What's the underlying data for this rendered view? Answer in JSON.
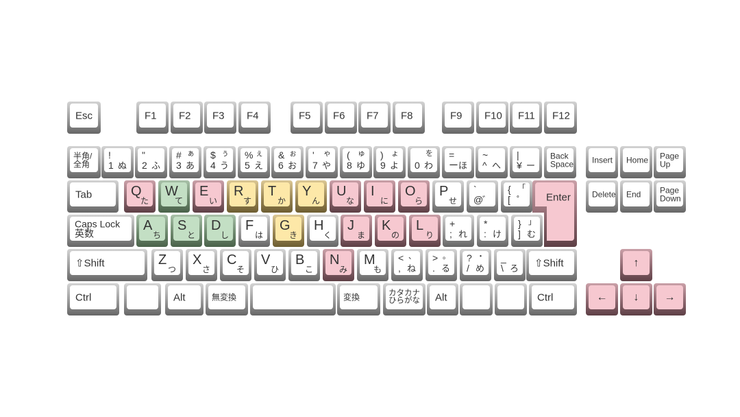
{
  "colors": {
    "default": "#ffffff",
    "pink": "#f6c8d0",
    "green": "#c3dfc4",
    "yellow": "#fde8a8"
  },
  "keys": [
    {
      "id": "esc",
      "label": "Esc",
      "type": "name",
      "color": "default"
    },
    {
      "id": "f1",
      "label": "F1",
      "type": "name",
      "color": "default"
    },
    {
      "id": "f2",
      "label": "F2",
      "type": "name",
      "color": "default"
    },
    {
      "id": "f3",
      "label": "F3",
      "type": "name",
      "color": "default"
    },
    {
      "id": "f4",
      "label": "F4",
      "type": "name",
      "color": "default"
    },
    {
      "id": "f5",
      "label": "F5",
      "type": "name",
      "color": "default"
    },
    {
      "id": "f6",
      "label": "F6",
      "type": "name",
      "color": "default"
    },
    {
      "id": "f7",
      "label": "F7",
      "type": "name",
      "color": "default"
    },
    {
      "id": "f8",
      "label": "F8",
      "type": "name",
      "color": "default"
    },
    {
      "id": "f9",
      "label": "F9",
      "type": "name",
      "color": "default"
    },
    {
      "id": "f10",
      "label": "F10",
      "type": "name",
      "color": "default"
    },
    {
      "id": "f11",
      "label": "F11",
      "type": "name",
      "color": "default"
    },
    {
      "id": "f12",
      "label": "F12",
      "type": "name",
      "color": "default"
    },
    {
      "id": "hankaku",
      "label": "半角/\n全角",
      "type": "name-small",
      "color": "default"
    },
    {
      "id": "k1",
      "tl": "!",
      "tr": "",
      "bl": "1",
      "br": "ぬ",
      "type": "num",
      "color": "default"
    },
    {
      "id": "k2",
      "tl": "\"",
      "tr": "",
      "bl": "2",
      "br": "ふ",
      "type": "num",
      "color": "default"
    },
    {
      "id": "k3",
      "tl": "#",
      "tr": "ぁ",
      "bl": "3",
      "br": "あ",
      "type": "num",
      "color": "default"
    },
    {
      "id": "k4",
      "tl": "$",
      "tr": "ぅ",
      "bl": "4",
      "br": "う",
      "type": "num",
      "color": "default"
    },
    {
      "id": "k5",
      "tl": "%",
      "tr": "ぇ",
      "bl": "5",
      "br": "え",
      "type": "num",
      "color": "default"
    },
    {
      "id": "k6",
      "tl": "&",
      "tr": "ぉ",
      "bl": "6",
      "br": "お",
      "type": "num",
      "color": "default"
    },
    {
      "id": "k7",
      "tl": "'",
      "tr": "ゃ",
      "bl": "7",
      "br": "や",
      "type": "num",
      "color": "default"
    },
    {
      "id": "k8",
      "tl": "(",
      "tr": "ゅ",
      "bl": "8",
      "br": "ゆ",
      "type": "num",
      "color": "default"
    },
    {
      "id": "k9",
      "tl": ")",
      "tr": "ょ",
      "bl": "9",
      "br": "よ",
      "type": "num",
      "color": "default"
    },
    {
      "id": "k0",
      "tl": "",
      "tr": "を",
      "bl": "0",
      "br": "わ",
      "type": "num",
      "color": "default"
    },
    {
      "id": "minus",
      "tl": "=",
      "tr": "",
      "bl": "ー",
      "br": "ほ",
      "type": "num",
      "color": "default"
    },
    {
      "id": "caret",
      "tl": "~",
      "tr": "",
      "bl": "^",
      "br": "へ",
      "type": "num",
      "color": "default"
    },
    {
      "id": "yen",
      "tl": "|",
      "tr": "",
      "bl": "¥",
      "br": "ー",
      "type": "num",
      "color": "default"
    },
    {
      "id": "backspace",
      "label": "Back\nSpace",
      "type": "name-small",
      "color": "default"
    },
    {
      "id": "tab",
      "label": "Tab",
      "type": "name",
      "color": "default"
    },
    {
      "id": "q",
      "tl": "Q",
      "br": "た",
      "type": "alpha",
      "color": "pink"
    },
    {
      "id": "w",
      "tl": "W",
      "br": "て",
      "type": "alpha",
      "color": "green"
    },
    {
      "id": "e",
      "tl": "E",
      "br": "い",
      "type": "alpha",
      "color": "pink"
    },
    {
      "id": "r",
      "tl": "R",
      "br": "す",
      "type": "alpha",
      "color": "yellow"
    },
    {
      "id": "t",
      "tl": "T",
      "br": "か",
      "type": "alpha",
      "color": "yellow"
    },
    {
      "id": "y",
      "tl": "Y",
      "br": "ん",
      "type": "alpha",
      "color": "yellow"
    },
    {
      "id": "u",
      "tl": "U",
      "br": "な",
      "type": "alpha",
      "color": "pink"
    },
    {
      "id": "i",
      "tl": "I",
      "br": "に",
      "type": "alpha",
      "color": "pink"
    },
    {
      "id": "o",
      "tl": "O",
      "br": "ら",
      "type": "alpha",
      "color": "pink"
    },
    {
      "id": "p",
      "tl": "P",
      "br": "せ",
      "type": "alpha",
      "color": "default"
    },
    {
      "id": "at",
      "tl": "`",
      "tr": "",
      "bl": "@",
      "br": "゛",
      "type": "num",
      "color": "default"
    },
    {
      "id": "lbracket",
      "tl": "{",
      "tr": "「",
      "bl": "[",
      "br": "゜",
      "type": "num",
      "color": "default"
    },
    {
      "id": "enter",
      "label": "Enter",
      "type": "enter",
      "color": "pink"
    },
    {
      "id": "capslock",
      "label": "Caps Lock\n英数",
      "type": "name-caps",
      "color": "default"
    },
    {
      "id": "a",
      "tl": "A",
      "br": "ち",
      "type": "alpha",
      "color": "green"
    },
    {
      "id": "s",
      "tl": "S",
      "br": "と",
      "type": "alpha",
      "color": "green"
    },
    {
      "id": "d",
      "tl": "D",
      "br": "し",
      "type": "alpha",
      "color": "green"
    },
    {
      "id": "f",
      "tl": "F",
      "br": "は",
      "type": "alpha",
      "color": "default"
    },
    {
      "id": "g",
      "tl": "G",
      "br": "き",
      "type": "alpha",
      "color": "yellow"
    },
    {
      "id": "h",
      "tl": "H",
      "br": "く",
      "type": "alpha",
      "color": "default"
    },
    {
      "id": "j",
      "tl": "J",
      "br": "ま",
      "type": "alpha",
      "color": "pink"
    },
    {
      "id": "k",
      "tl": "K",
      "br": "の",
      "type": "alpha",
      "color": "pink"
    },
    {
      "id": "l",
      "tl": "L",
      "br": "り",
      "type": "alpha",
      "color": "pink"
    },
    {
      "id": "semicolon",
      "tl": "+",
      "tr": "",
      "bl": ";",
      "br": "れ",
      "type": "num",
      "color": "default"
    },
    {
      "id": "colon",
      "tl": "*",
      "tr": "",
      "bl": ":",
      "br": "け",
      "type": "num",
      "color": "default"
    },
    {
      "id": "rbracket",
      "tl": "}",
      "tr": "」",
      "bl": "]",
      "br": "む",
      "type": "num",
      "color": "default"
    },
    {
      "id": "lshift",
      "label": "⇧Shift",
      "type": "name",
      "color": "default"
    },
    {
      "id": "z",
      "tl": "Z",
      "br": "つ",
      "type": "alpha",
      "color": "default"
    },
    {
      "id": "x",
      "tl": "X",
      "br": "さ",
      "type": "alpha",
      "color": "default"
    },
    {
      "id": "c",
      "tl": "C",
      "br": "そ",
      "type": "alpha",
      "color": "default"
    },
    {
      "id": "v",
      "tl": "V",
      "br": "ひ",
      "type": "alpha",
      "color": "default"
    },
    {
      "id": "b",
      "tl": "B",
      "br": "こ",
      "type": "alpha",
      "color": "default"
    },
    {
      "id": "n",
      "tl": "N",
      "br": "み",
      "type": "alpha",
      "color": "pink"
    },
    {
      "id": "m",
      "tl": "M",
      "br": "も",
      "type": "alpha",
      "color": "default"
    },
    {
      "id": "comma",
      "tl": "<",
      "tr": "、",
      "bl": ",",
      "br": "ね",
      "type": "num",
      "color": "default"
    },
    {
      "id": "period",
      "tl": ">",
      "tr": "。",
      "bl": ".",
      "br": "る",
      "type": "num",
      "color": "default"
    },
    {
      "id": "slash",
      "tl": "?",
      "tr": "・",
      "bl": "/",
      "br": "め",
      "type": "num",
      "color": "default"
    },
    {
      "id": "backslash",
      "tl": "_",
      "tr": "",
      "bl": "\\",
      "br": "ろ",
      "type": "num",
      "color": "default"
    },
    {
      "id": "rshift",
      "label": "⇧Shift",
      "type": "name",
      "color": "default"
    },
    {
      "id": "lctrl",
      "label": "Ctrl",
      "type": "name",
      "color": "default"
    },
    {
      "id": "lwin",
      "label": "",
      "type": "name",
      "color": "default"
    },
    {
      "id": "lalt",
      "label": "Alt",
      "type": "name",
      "color": "default"
    },
    {
      "id": "muhenkan",
      "label": "無変換",
      "type": "name-small",
      "color": "default"
    },
    {
      "id": "space",
      "label": "",
      "type": "name",
      "color": "default"
    },
    {
      "id": "henkan",
      "label": "変換",
      "type": "name-small",
      "color": "default"
    },
    {
      "id": "katakana",
      "label": "カタカナ\nひらがな",
      "type": "name-tiny",
      "color": "default"
    },
    {
      "id": "ralt",
      "label": "Alt",
      "type": "name",
      "color": "default"
    },
    {
      "id": "rwin",
      "label": "",
      "type": "name",
      "color": "default"
    },
    {
      "id": "menu",
      "label": "",
      "type": "name",
      "color": "default"
    },
    {
      "id": "rctrl",
      "label": "Ctrl",
      "type": "name",
      "color": "default"
    },
    {
      "id": "insert",
      "label": "Insert",
      "type": "name-small",
      "color": "default"
    },
    {
      "id": "home",
      "label": "Home",
      "type": "name-small",
      "color": "default"
    },
    {
      "id": "pageup",
      "label": "Page\nUp",
      "type": "name-small",
      "color": "default"
    },
    {
      "id": "delete",
      "label": "Delete",
      "type": "name-small",
      "color": "default"
    },
    {
      "id": "end",
      "label": "End",
      "type": "name-small",
      "color": "default"
    },
    {
      "id": "pagedown",
      "label": "Page\nDown",
      "type": "name-small",
      "color": "default"
    },
    {
      "id": "up",
      "label": "↑",
      "type": "arrow",
      "color": "pink"
    },
    {
      "id": "left",
      "label": "←",
      "type": "arrow",
      "color": "pink"
    },
    {
      "id": "down",
      "label": "↓",
      "type": "arrow",
      "color": "pink"
    },
    {
      "id": "right",
      "label": "→",
      "type": "arrow",
      "color": "pink"
    }
  ]
}
